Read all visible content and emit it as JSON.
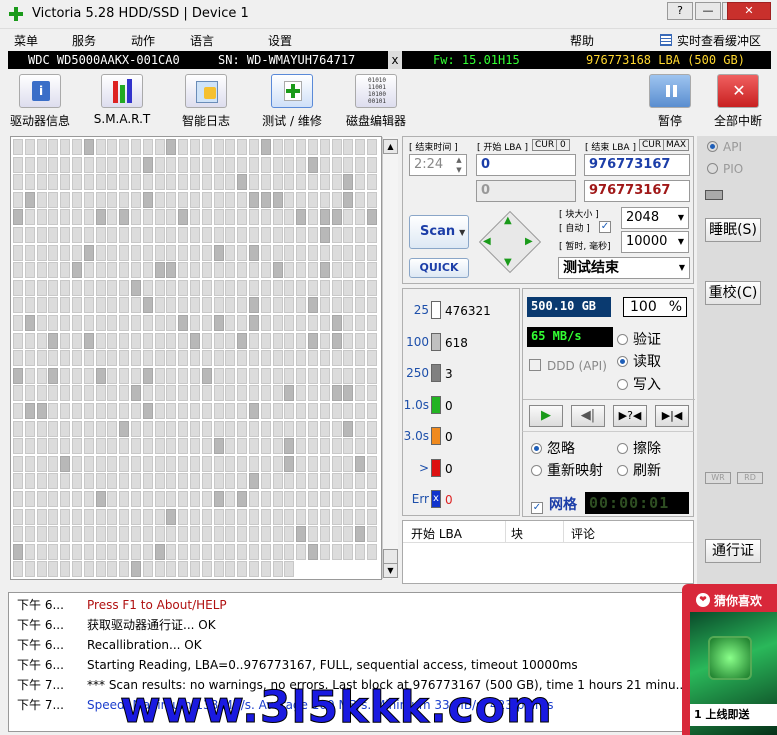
{
  "window": {
    "title": "Victoria 5.28 HDD/SSD | Device 1",
    "btn_help": "?",
    "btn_min": "—",
    "btn_max": "□",
    "btn_close": "✕"
  },
  "menu": {
    "items": [
      "菜单",
      "服务",
      "动作",
      "语言",
      "设置"
    ],
    "help": "帮助",
    "realtime": "实时查看缓冲区"
  },
  "info": {
    "model": "WDC WD5000AAKX-001CA0",
    "serial": "SN: WD-WMAYUH764717",
    "x": "x",
    "fw": "Fw: 15.01H15",
    "lba": "976773168 LBA (500 GB)"
  },
  "toolbar": {
    "drive_info": "驱动器信息",
    "smart": "S.M.A.R.T",
    "smart_log": "智能日志",
    "test_repair": "测试 / 维修",
    "disk_editor": "磁盘编辑器",
    "pause": "暂停",
    "stop_all": "全部中断"
  },
  "params": {
    "end_time_lbl": "[ 结束时间 ]",
    "start_lba_lbl": "[ 开始 LBA ]",
    "cur": "CUR",
    "zero": "0",
    "end_lba_lbl": "[ 结束 LBA ]",
    "max": "MAX",
    "time": "2:24",
    "start_lba": "0",
    "end_lba": "976773167",
    "start_lba2": "0",
    "end_lba2": "976773167",
    "block_lbl": "[ 块大小 ]",
    "auto_lbl": "[ 自动 ]",
    "timeout_lbl": "[ 暂时, 毫秒]",
    "block_size": "2048",
    "timeout": "10000",
    "scan": "Scan",
    "quick": "QUICK",
    "status": "测试结束"
  },
  "stats": [
    {
      "label": "25",
      "count": "476321",
      "color": "#ffffff",
      "lbl_color": "#1d4faa"
    },
    {
      "label": "100",
      "count": "618",
      "color": "#c0c0c0",
      "lbl_color": "#1d4faa"
    },
    {
      "label": "250",
      "count": "3",
      "color": "#808080",
      "lbl_color": "#1d4faa"
    },
    {
      "label": "1.0s",
      "count": "0",
      "color": "#22b422",
      "lbl_color": "#1d4faa"
    },
    {
      "label": "3.0s",
      "count": "0",
      "color": "#f08a1e",
      "lbl_color": "#1d4faa"
    },
    {
      "label": ">",
      "count": "0",
      "color": "#dd1111",
      "lbl_color": "#1d4faa"
    },
    {
      "label": "Err",
      "count": "0",
      "color": "#1133cc",
      "lbl_color": "#1d4faa"
    }
  ],
  "progress": {
    "size": "500.10 GB",
    "percent": "100",
    "pct_sign": "%",
    "speed": "65 MB/s",
    "ddd": "DDD (API)",
    "verify": "验证",
    "read": "读取",
    "write": "写入"
  },
  "actions": {
    "ignore": "忽略",
    "erase": "擦除",
    "remap": "重新映射",
    "refresh": "刷新",
    "grid": "网格",
    "timer": "00:00:01"
  },
  "table": {
    "col_lba": "开始 LBA",
    "col_block": "块",
    "col_comment": "评论"
  },
  "side": {
    "api": "API",
    "pio": "PIO",
    "sleep": "睡眠(S)",
    "recal": "重校(C)",
    "wr": "WR",
    "rd": "RD",
    "passport": "通行证"
  },
  "log": [
    {
      "time": "下午 6...",
      "msg": "Press F1 to About/HELP",
      "color": "#b01010"
    },
    {
      "time": "下午 6...",
      "msg": "获取驱动器通行证... OK",
      "color": "#000000"
    },
    {
      "time": "下午 6...",
      "msg": "Recallibration... OK",
      "color": "#000000"
    },
    {
      "time": "下午 6...",
      "msg": "Starting Reading, LBA=0..976773167, FULL, sequential access, timeout 10000ms",
      "color": "#000000"
    },
    {
      "time": "下午 7...",
      "msg": "*** Scan results: no warnings, no errors. Last block at 976773167 (500 GB), time 1 hours 21 minu...",
      "color": "#000000"
    },
    {
      "time": "下午 7...",
      "msg": "Speed: Maximum 138 MB/s. Average 100 MB/s. Minimum 33 MB/s. 423 points",
      "color": "#1a3dcc"
    }
  ],
  "ad": {
    "title": "猜你喜欢",
    "text": "1 上线即送"
  },
  "watermark": "www.3l5kkk.com"
}
